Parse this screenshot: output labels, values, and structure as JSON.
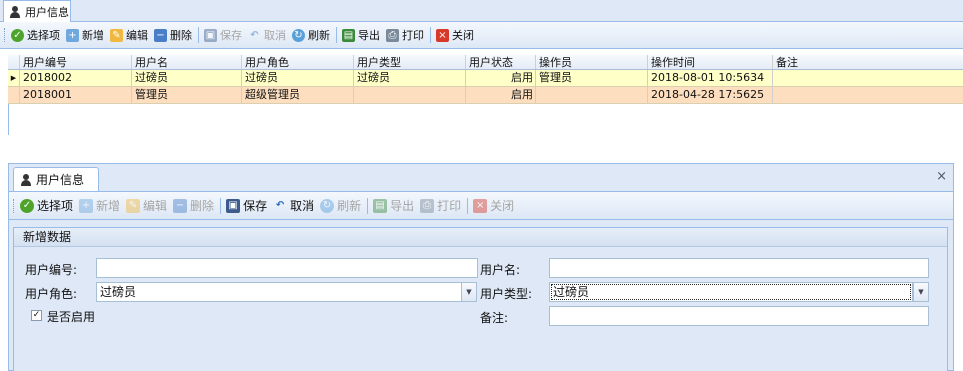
{
  "top_panel": {
    "tab_title": "用户信息",
    "toolbar": {
      "select": "选择项",
      "add": "新增",
      "edit": "编辑",
      "delete": "删除",
      "save": "保存",
      "cancel": "取消",
      "refresh": "刷新",
      "export": "导出",
      "print": "打印",
      "close": "关闭"
    },
    "grid": {
      "columns": [
        "用户编号",
        "用户名",
        "用户角色",
        "用户类型",
        "用户状态",
        "操作员",
        "操作时间",
        "备注"
      ],
      "rows": [
        [
          "2018002",
          "过磅员",
          "过磅员",
          "过磅员",
          "启用",
          "管理员",
          "2018-08-01 10:5634",
          ""
        ],
        [
          "2018001",
          "管理员",
          "超级管理员",
          "",
          "启用",
          "",
          "2018-04-28 17:5625",
          ""
        ]
      ],
      "row_colors": [
        "#ffffc8",
        "#fddfc0"
      ]
    }
  },
  "bottom_panel": {
    "tab_title": "用户信息",
    "close_symbol": "×",
    "toolbar": {
      "select": "选择项",
      "add": "新增",
      "edit": "编辑",
      "delete": "删除",
      "save": "保存",
      "cancel": "取消",
      "refresh": "刷新",
      "export": "导出",
      "print": "打印",
      "close": "关闭"
    },
    "form": {
      "section_title": "新增数据",
      "user_id_label": "用户编号:",
      "user_id_value": "",
      "user_name_label": "用户名:",
      "user_name_value": "",
      "user_role_label": "用户角色:",
      "user_role_value": "过磅员",
      "user_type_label": "用户类型:",
      "user_type_value": "过磅员",
      "enabled_label": "是否启用",
      "enabled_checked": "✓",
      "remark_label": "备注:",
      "remark_value": ""
    }
  }
}
